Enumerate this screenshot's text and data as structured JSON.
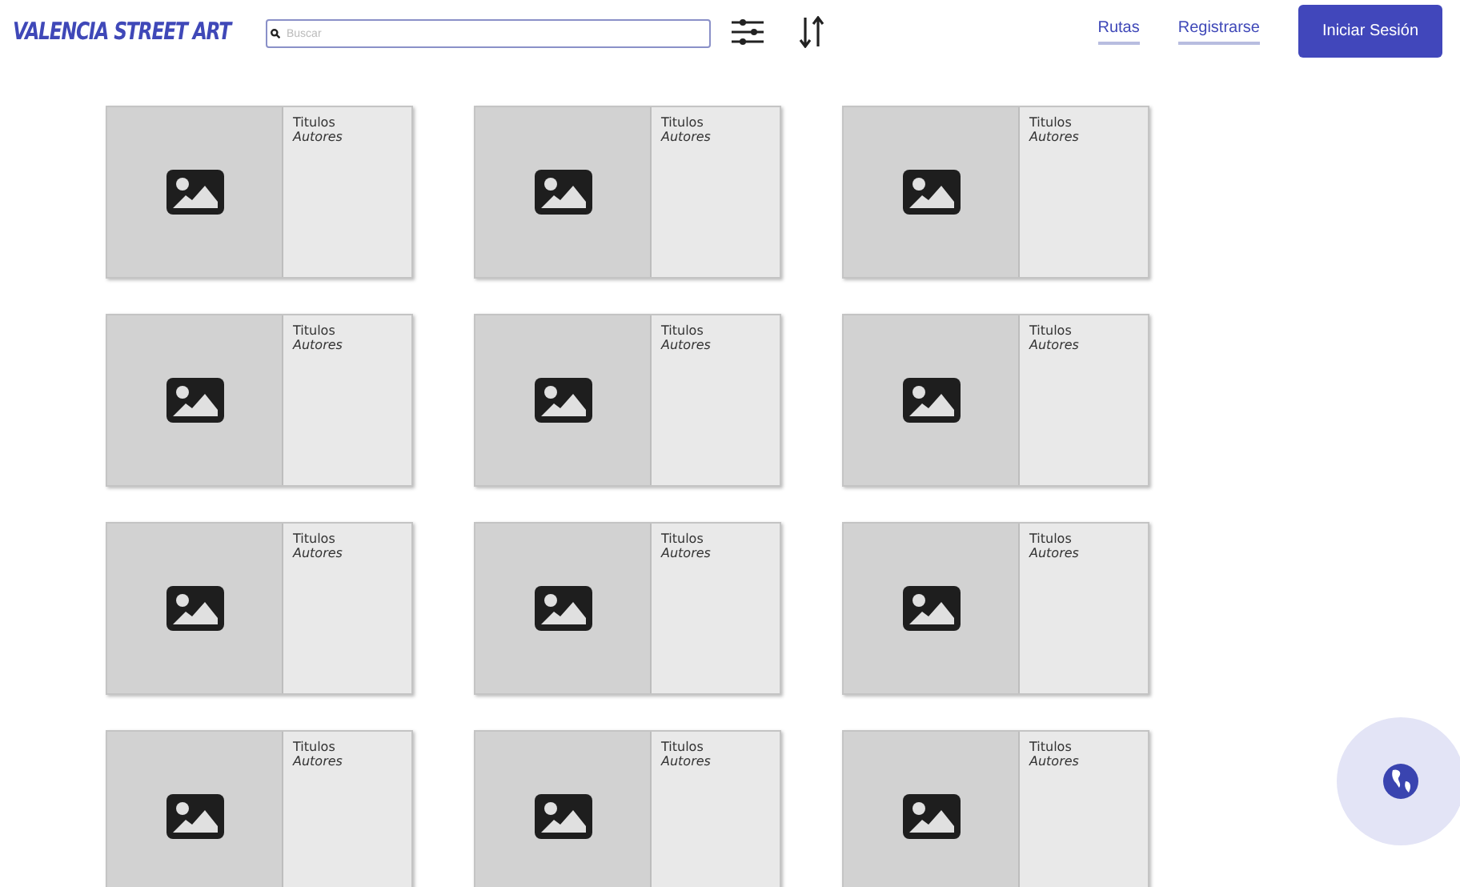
{
  "header": {
    "logo": "VALENCIA STREET ART",
    "search": {
      "placeholder": "Buscar"
    },
    "links": [
      "Rutas",
      "Registrarse"
    ],
    "login_button": "Iniciar Sesión"
  },
  "cards": [
    {
      "title": "Titulos",
      "author": "Autores"
    },
    {
      "title": "Titulos",
      "author": "Autores"
    },
    {
      "title": "Titulos",
      "author": "Autores"
    },
    {
      "title": "Titulos",
      "author": "Autores"
    },
    {
      "title": "Titulos",
      "author": "Autores"
    },
    {
      "title": "Titulos",
      "author": "Autores"
    },
    {
      "title": "Titulos",
      "author": "Autores"
    },
    {
      "title": "Titulos",
      "author": "Autores"
    },
    {
      "title": "Titulos",
      "author": "Autores"
    },
    {
      "title": "Titulos",
      "author": "Autores"
    },
    {
      "title": "Titulos",
      "author": "Autores"
    },
    {
      "title": "Titulos",
      "author": "Autores"
    }
  ]
}
